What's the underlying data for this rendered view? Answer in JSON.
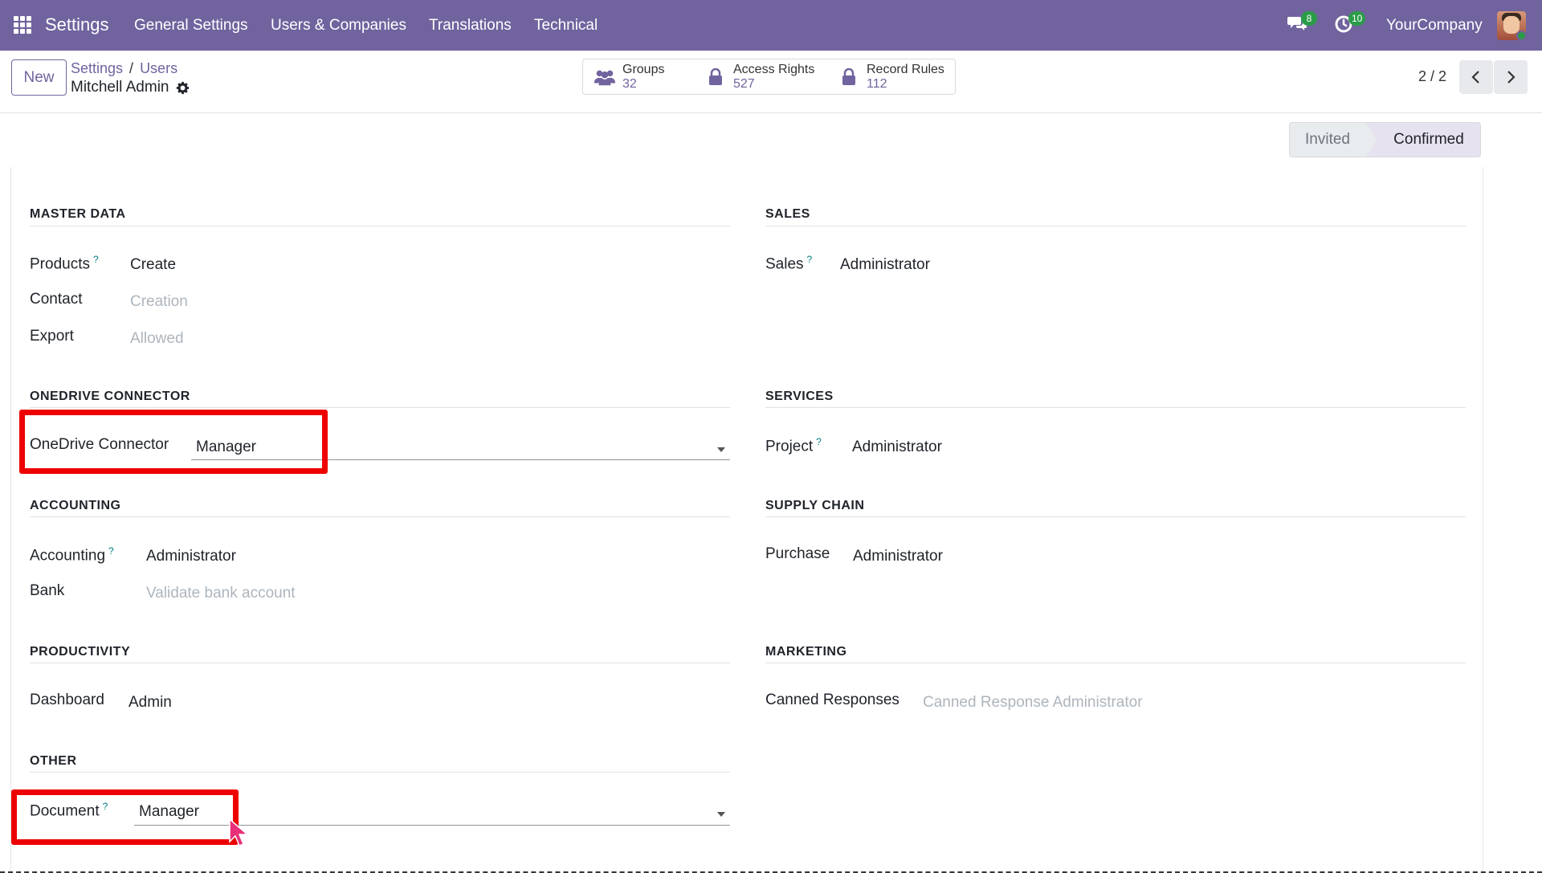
{
  "nav": {
    "app_name": "Settings",
    "menus": [
      "General Settings",
      "Users & Companies",
      "Translations",
      "Technical"
    ],
    "chat_count": "8",
    "activity_count": "10",
    "company": "YourCompany"
  },
  "control": {
    "new_label": "New",
    "breadcrumb": [
      "Settings",
      "Users"
    ],
    "breadcrumb_sep": "/",
    "record_title": "Mitchell Admin",
    "smart_buttons": [
      {
        "label": "Groups",
        "value": "32"
      },
      {
        "label": "Access Rights",
        "value": "527"
      },
      {
        "label": "Record Rules",
        "value": "112"
      }
    ],
    "pager": "2 / 2",
    "status": [
      "Invited",
      "Confirmed"
    ]
  },
  "sections": {
    "master_data": {
      "title": "MASTER DATA",
      "fields": [
        {
          "label": "Products",
          "value": "Create"
        },
        {
          "label": "Contact",
          "value": "Creation"
        },
        {
          "label": "Export",
          "value": "Allowed"
        }
      ]
    },
    "sales": {
      "title": "SALES",
      "fields": [
        {
          "label": "Sales",
          "value": "Administrator"
        }
      ]
    },
    "onedrive": {
      "title": "ONEDRIVE CONNECTOR",
      "fields": [
        {
          "label": "OneDrive Connector",
          "value": "Manager"
        }
      ]
    },
    "services": {
      "title": "SERVICES",
      "fields": [
        {
          "label": "Project",
          "value": "Administrator"
        }
      ]
    },
    "accounting": {
      "title": "ACCOUNTING",
      "fields": [
        {
          "label": "Accounting",
          "value": "Administrator"
        },
        {
          "label": "Bank",
          "value": "Validate bank account"
        }
      ]
    },
    "supply_chain": {
      "title": "SUPPLY CHAIN",
      "fields": [
        {
          "label": "Purchase",
          "value": "Administrator"
        }
      ]
    },
    "productivity": {
      "title": "PRODUCTIVITY",
      "fields": [
        {
          "label": "Dashboard",
          "value": "Admin"
        }
      ]
    },
    "marketing": {
      "title": "MARKETING",
      "fields": [
        {
          "label": "Canned Responses",
          "value": "Canned Response Administrator"
        }
      ]
    },
    "other": {
      "title": "OTHER",
      "fields": [
        {
          "label": "Document",
          "value": "Manager"
        }
      ]
    }
  },
  "help_mark": "?",
  "colors": {
    "nav": "#71639e",
    "highlight": "#ee0000",
    "badge": "#2a9c48",
    "help": "#017e84"
  }
}
